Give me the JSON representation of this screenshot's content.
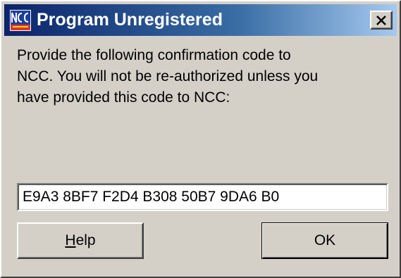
{
  "window": {
    "title": "Program Unregistered",
    "app_icon": "ncc-logo-icon",
    "close_icon": "close-icon"
  },
  "message": {
    "text": "Provide the following confirmation code to\nNCC.  You will not be re-authorized unless you\nhave provided this code to NCC:"
  },
  "code_field": {
    "value": "E9A3 8BF7 F2D4 B308 50B7 9DA6 B0"
  },
  "buttons": {
    "help_mnemonic": "H",
    "help_rest": "elp",
    "ok_label": "OK"
  },
  "colors": {
    "titlebar_start": "#0a246a",
    "titlebar_end": "#a6caf0",
    "face": "#d4d0c8"
  }
}
